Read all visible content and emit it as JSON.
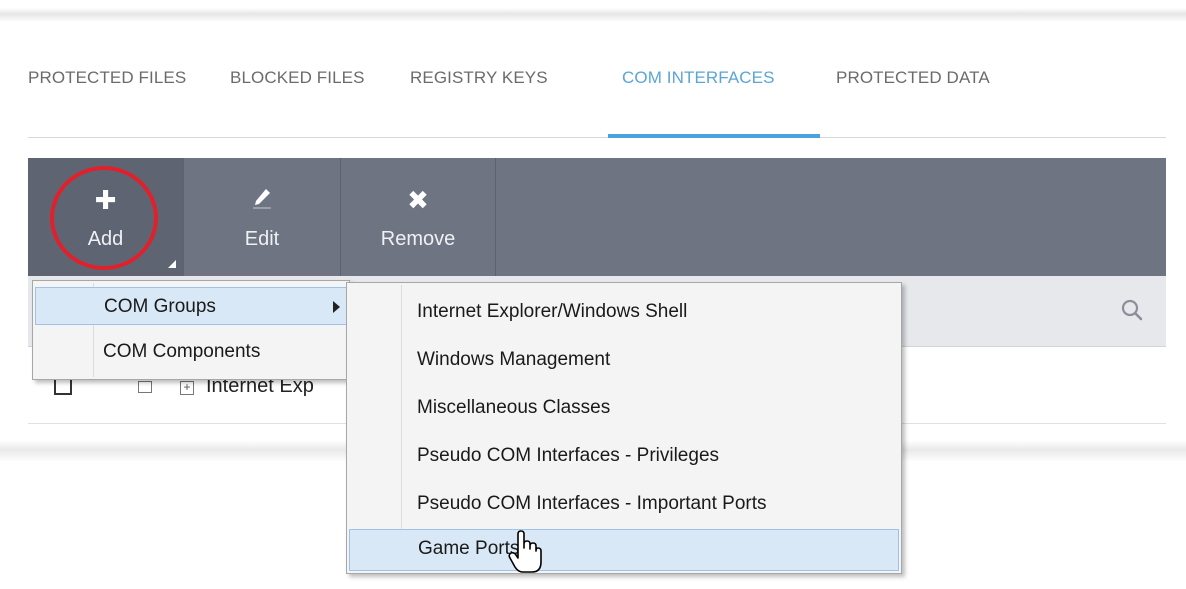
{
  "tabs": [
    {
      "label": "PROTECTED FILES",
      "active": false
    },
    {
      "label": "BLOCKED FILES",
      "active": false
    },
    {
      "label": "REGISTRY KEYS",
      "active": false
    },
    {
      "label": "COM INTERFACES",
      "active": true
    },
    {
      "label": "PROTECTED DATA",
      "active": false
    }
  ],
  "toolbar": {
    "add_label": "Add",
    "edit_label": "Edit",
    "remove_label": "Remove"
  },
  "grid": {
    "rows": [
      {
        "label": "Internet Exp"
      }
    ]
  },
  "add_menu": {
    "items": [
      {
        "label": "COM Groups",
        "highlighted": true,
        "has_submenu": true
      },
      {
        "label": "COM Components",
        "highlighted": false,
        "has_submenu": false
      }
    ]
  },
  "com_groups_menu": {
    "items": [
      {
        "label": "Internet Explorer/Windows Shell",
        "highlighted": false
      },
      {
        "label": "Windows Management",
        "highlighted": false
      },
      {
        "label": "Miscellaneous Classes",
        "highlighted": false
      },
      {
        "label": "Pseudo COM Interfaces - Privileges",
        "highlighted": false
      },
      {
        "label": "Pseudo COM Interfaces - Important Ports",
        "highlighted": false
      },
      {
        "label": "Game Ports",
        "highlighted": true
      }
    ]
  },
  "colors": {
    "accent": "#4aa3df",
    "toolbar_bg": "#6f7483",
    "highlight_annotation": "#e0202a",
    "menu_highlight": "#d9e8f7"
  },
  "icons": {
    "add": "plus-icon",
    "edit": "pencil-icon",
    "remove": "x-icon",
    "search": "search-icon"
  }
}
